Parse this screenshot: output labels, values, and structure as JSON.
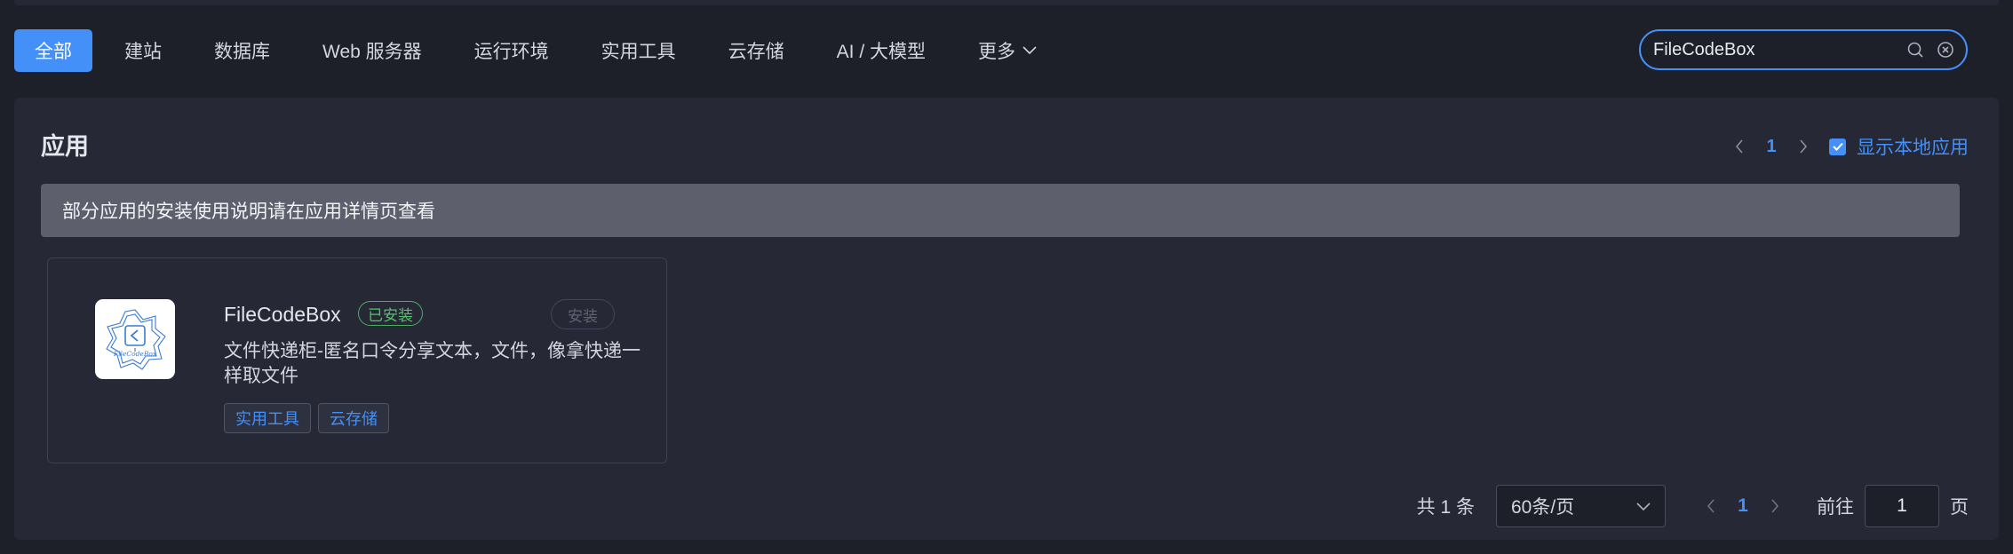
{
  "tabs": [
    {
      "label": "全部",
      "active": true
    },
    {
      "label": "建站"
    },
    {
      "label": "数据库"
    },
    {
      "label": "Web 服务器"
    },
    {
      "label": "运行环境"
    },
    {
      "label": "实用工具"
    },
    {
      "label": "云存储"
    },
    {
      "label": "AI / 大模型"
    },
    {
      "label": "更多",
      "icon": "chevron-down-icon"
    }
  ],
  "search": {
    "value": "FileCodeBox",
    "icons": [
      "search-icon",
      "clear-icon"
    ]
  },
  "panel": {
    "title": "应用",
    "page": "1",
    "show_local_label": "显示本地应用",
    "show_local_checked": true,
    "notice": "部分应用的安装使用说明请在应用详情页查看"
  },
  "app": {
    "name": "FileCodeBox",
    "status": "已安装",
    "install_label": "安装",
    "description": "文件快递柜-匿名口令分享文本，文件，像拿快递一样取文件",
    "tags": [
      "实用工具",
      "云存储"
    ],
    "logo_text": "FileCodeBox"
  },
  "pagination": {
    "total": "共 1 条",
    "page_size": "60条/页",
    "current": "1",
    "goto_label": "前往",
    "goto_value": "1",
    "page_suffix": "页"
  },
  "colors": {
    "accent": "#4390f8",
    "background": "#1e2029",
    "panel": "#262836",
    "installed": "#55c267"
  }
}
